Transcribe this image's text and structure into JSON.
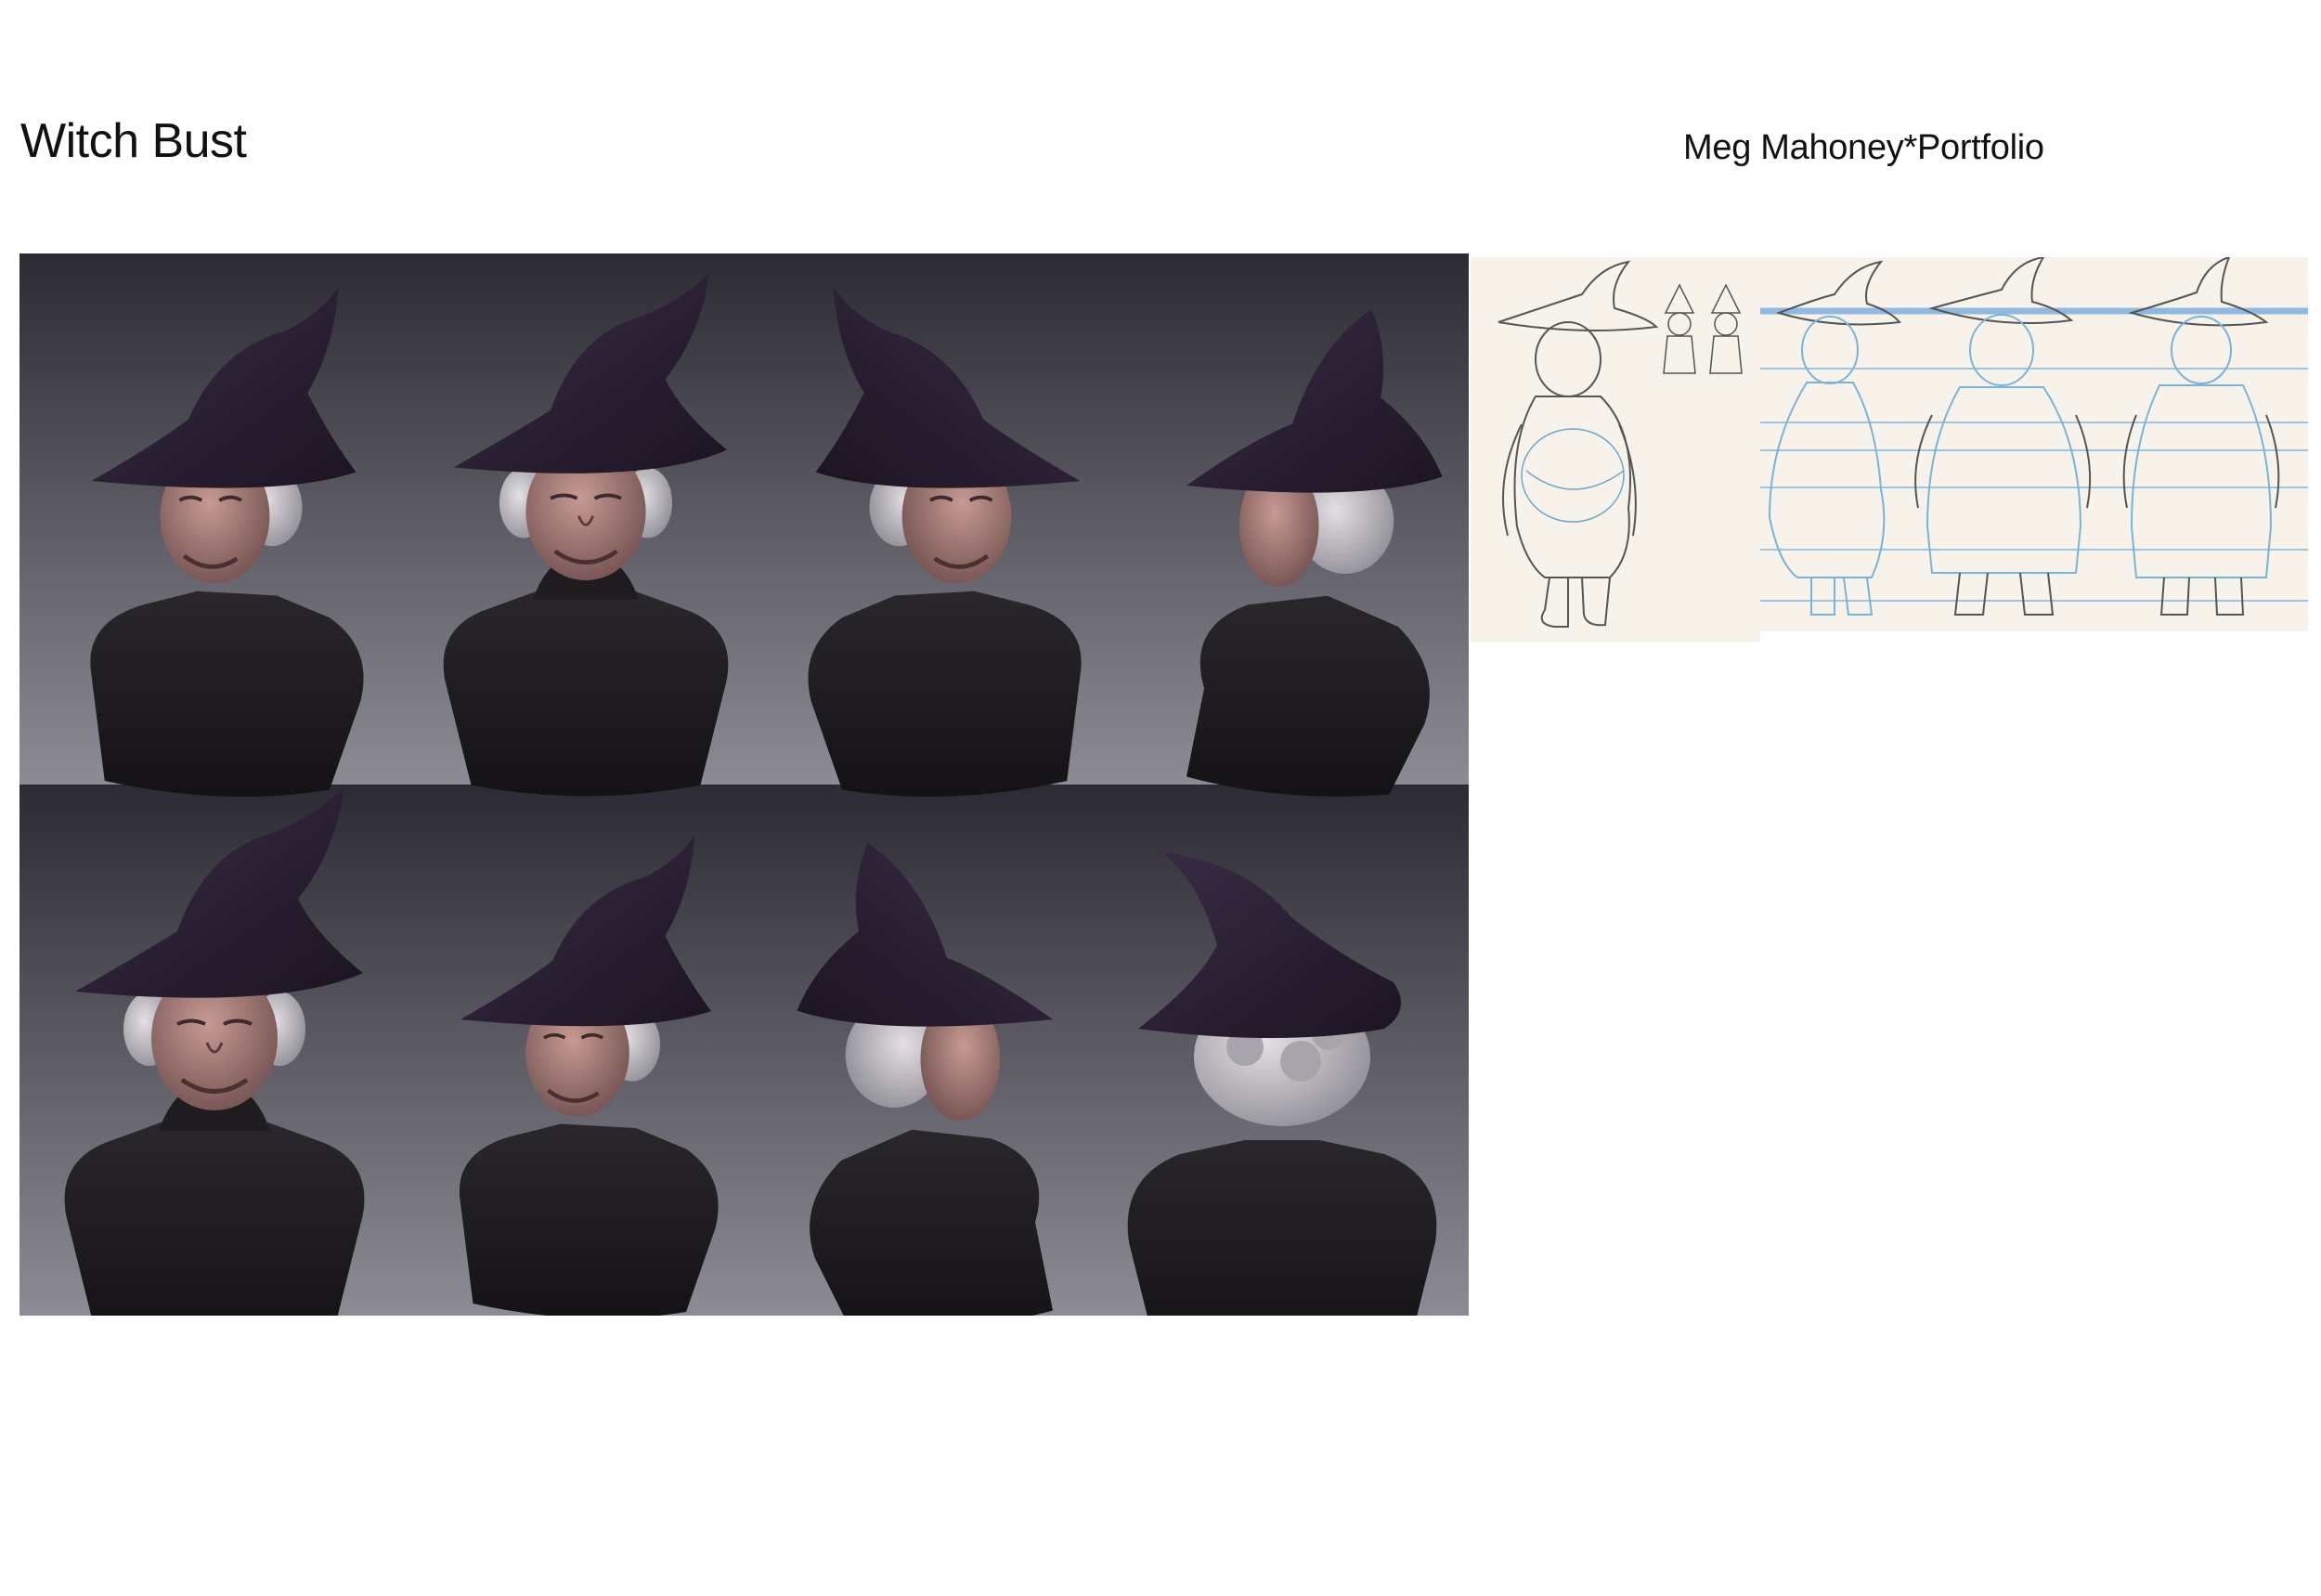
{
  "header": {
    "title": "Witch Bust",
    "author_line": "Meg Mahoney*Portfolio"
  },
  "colors": {
    "background": "#ffffff",
    "panel_top": "#2c2a33",
    "panel_bottom": "#8d8b93",
    "hat": "#2b1f34",
    "body": "#1d1b1d",
    "skin": "#9c7876",
    "hair": "#bdbbc0",
    "paper": "#f7f3ea",
    "sketch_blue": "#78b4d8",
    "pencil": "#555555"
  },
  "render_rows": [
    {
      "row": "top",
      "views": [
        "three-quarter-left",
        "front",
        "three-quarter-right",
        "profile-right"
      ]
    },
    {
      "row": "bottom",
      "views": [
        "front-up",
        "three-quarter-down",
        "profile-back",
        "back"
      ]
    }
  ],
  "sketches": [
    "concept-sketch",
    "turnaround-sheet"
  ]
}
